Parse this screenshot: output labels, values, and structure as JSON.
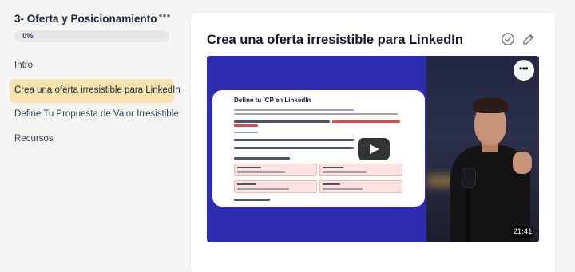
{
  "sidebar": {
    "module_title": "3- Oferta y Posicionamiento",
    "menu_icon": "more-horizontal-icon",
    "progress": {
      "label": "0%",
      "value": 0
    },
    "lessons": [
      {
        "label": "Intro",
        "active": false
      },
      {
        "label": "Crea una oferta irresistible para LinkedIn",
        "active": true
      },
      {
        "label": "Define Tu Propuesta de Valor Irresistible",
        "active": false
      },
      {
        "label": "Recursos",
        "active": false
      }
    ]
  },
  "lesson": {
    "title": "Crea una oferta irresistible para LinkedIn",
    "actions": {
      "complete_icon": "check-circle-icon",
      "edit_icon": "pencil-icon"
    }
  },
  "video": {
    "duration": "21:41",
    "play_icon": "play-icon",
    "menu_icon": "more-horizontal-icon",
    "slide": {
      "title": "Define tu ICP en LinkedIn"
    }
  },
  "colors": {
    "active_lesson_bg": "#f7e2b0",
    "video_bg": "#2d2bb0",
    "progress_track": "#e5e7eb"
  }
}
